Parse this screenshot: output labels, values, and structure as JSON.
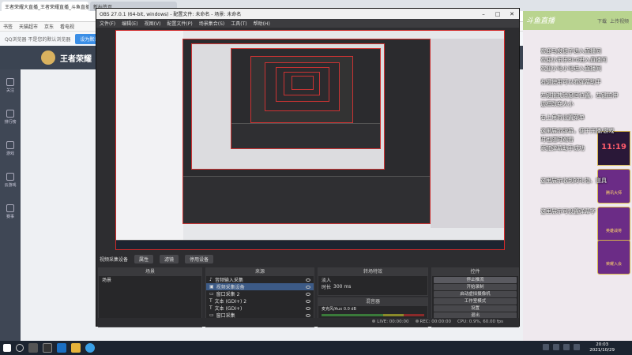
{
  "browser": {
    "tabs": [
      {
        "label": "王者荣耀大直播_王者荣耀直播_斗鱼直播"
      },
      {
        "label": "新标签页"
      }
    ],
    "bookmarks": [
      "书签",
      "天猫超市",
      "京东",
      "看电视"
    ],
    "gq_notice": "QQ浏览器 不是您的默认浏览器",
    "gq_button": "设为默认浏览器"
  },
  "site": {
    "brand": "王者荣耀",
    "sidebar": [
      {
        "label": "关注"
      },
      {
        "label": "排行榜"
      },
      {
        "label": "游戏"
      },
      {
        "label": "云游戏"
      },
      {
        "label": "赛事"
      }
    ]
  },
  "room": {
    "logo_text": "斗鱼直播",
    "toolbar": [
      "下载",
      "上传视频"
    ],
    "clock": "11:19",
    "gifts": [
      "腾讯大师",
      "英雄战将",
      "荣耀入会"
    ]
  },
  "overlay_chat": [
    "欢迎马良徒子进入直播间",
    "欢迎小乐乐Bird进入直播间",
    "欢迎小马小马进入直播间",
    "右键使用可以看弹幕助手",
    "左键拖拽消息区位置，左键拉伸",
    "边框改变大小",
    "右上角有设置菜单",
    "这里展示弹幕，便于开播/游戏",
    "时也随时观看",
    "添加弹幕助手成功",
    "这里展示收到的礼物、道具",
    "这里展示可设置弹幕字"
  ],
  "obs": {
    "title": "OBS 27.0.1 (64-bit, windows) - 配置文件: 未命名 - 场景: 未命名",
    "menu": [
      "文件(F)",
      "编辑(E)",
      "视图(V)",
      "配置文件(P)",
      "场景集合(S)",
      "工具(T)",
      "帮助(H)"
    ],
    "source_bar": {
      "label": "视频采集设备",
      "properties": "属性",
      "filters": "滤镜",
      "deactivate": "停用设备"
    },
    "scenes": {
      "title": "场景",
      "items": [
        "场景"
      ]
    },
    "sources": {
      "title": "来源",
      "items": [
        "音频输入采集",
        "视频采集设备",
        "窗口采集 2",
        "文本 (GDI+) 2",
        "文本 (GDI+)",
        "窗口采集"
      ]
    },
    "transitions": {
      "title": "转场特效",
      "type": "淡入",
      "duration_label": "时长",
      "duration": "300 ms"
    },
    "mixer": {
      "title": "混音器",
      "track": "麦克风/Aux",
      "level": "0.0 dB"
    },
    "controls": {
      "title": "控件",
      "buttons": [
        "停止推流",
        "开始录制",
        "启动虚拟摄像机",
        "工作室模式",
        "设置",
        "退出"
      ]
    },
    "status": {
      "live": "LIVE: 00:00:00",
      "rec": "REC: 00:00:00",
      "cpu": "CPU: 0.9%, 60.00 fps"
    }
  },
  "taskbar": {
    "time": "20:03",
    "date": "2021/10/29"
  },
  "colors": {
    "accent": "#3a8ee6",
    "preview_border": "#d12a2a",
    "selection": "#3c5a86"
  }
}
